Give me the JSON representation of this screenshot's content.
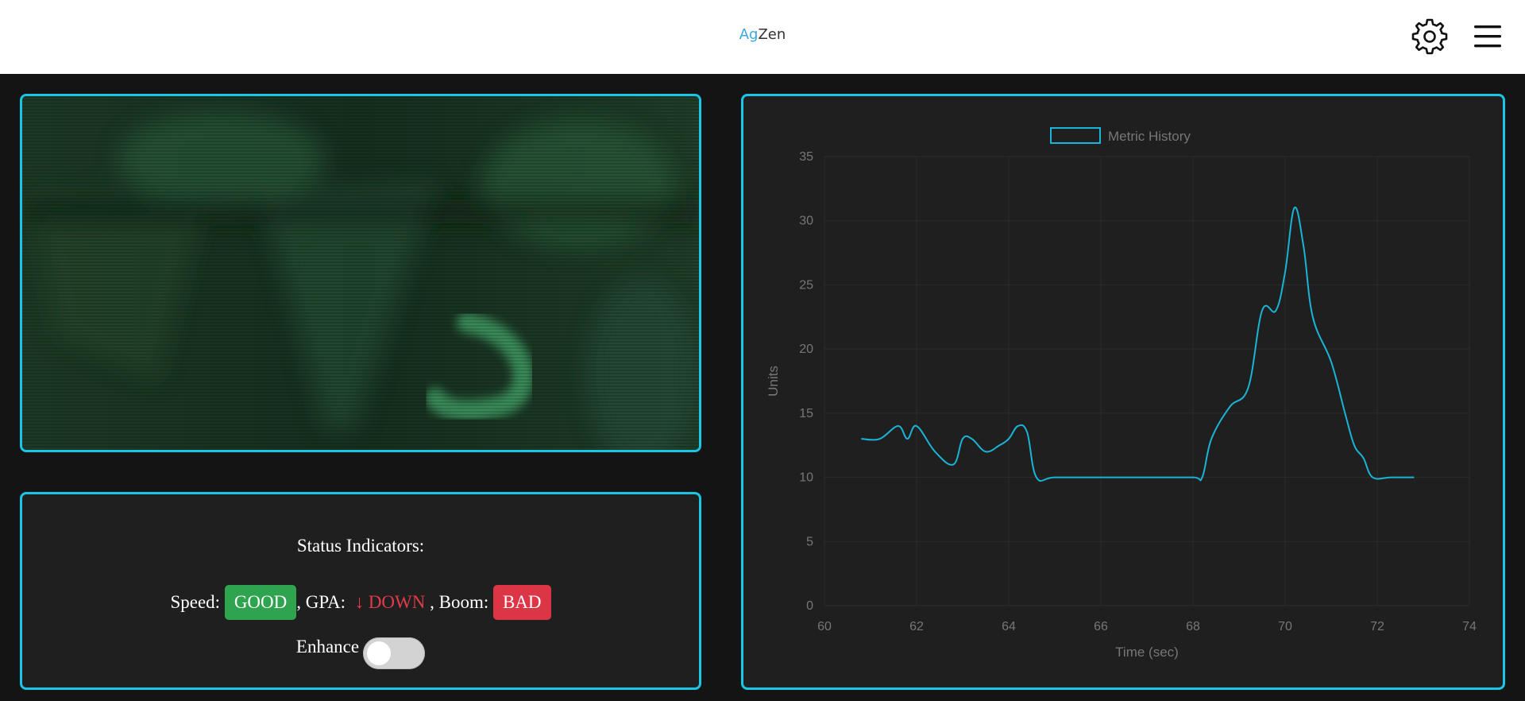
{
  "header": {
    "brand_part1": "Ag",
    "brand_part2": "Zen",
    "settings_icon": "gear-icon",
    "menu_icon": "hamburger-menu-icon"
  },
  "status": {
    "title": "Status Indicators:",
    "speed_label": "Speed: ",
    "speed_value": "GOOD",
    "gpa_label": ", GPA:  ",
    "gpa_arrow": "↓",
    "gpa_value": " DOWN",
    "boom_label": " , Boom: ",
    "boom_value": "BAD",
    "enhance_label": "Enhance",
    "enhance_on": false
  },
  "colors": {
    "accent": "#19c6e6",
    "good": "#2ea44f",
    "bad": "#dc3545",
    "down": "#e23b4b"
  },
  "chart_data": {
    "type": "line",
    "legend": [
      "Metric History"
    ],
    "legend_position": "top",
    "xlabel": "Time (sec)",
    "ylabel": "Units",
    "xlim": [
      60,
      74
    ],
    "ylim": [
      0,
      35
    ],
    "xticks": [
      60,
      62,
      64,
      66,
      68,
      70,
      72,
      74
    ],
    "yticks": [
      0,
      5,
      10,
      15,
      20,
      25,
      30,
      35
    ],
    "grid": true,
    "series": [
      {
        "name": "Metric History",
        "color": "#19b4d8",
        "x": [
          60.8,
          61.2,
          61.6,
          61.8,
          62.0,
          62.4,
          62.8,
          63.0,
          63.2,
          63.5,
          63.8,
          64.0,
          64.2,
          64.4,
          64.6,
          65.0,
          66.0,
          67.0,
          68.0,
          68.2,
          68.4,
          68.8,
          69.2,
          69.5,
          69.8,
          70.0,
          70.2,
          70.4,
          70.6,
          71.0,
          71.3,
          71.5,
          71.7,
          71.9,
          72.3,
          72.8
        ],
        "y": [
          13,
          13,
          14,
          13,
          14,
          12,
          11,
          13,
          13,
          12,
          12.5,
          13,
          14,
          13.5,
          10,
          10,
          10,
          10,
          10,
          10,
          13,
          15.5,
          17,
          23,
          23,
          26,
          31,
          28,
          22.5,
          19,
          15,
          12.5,
          11.5,
          10,
          10,
          10
        ]
      }
    ]
  }
}
